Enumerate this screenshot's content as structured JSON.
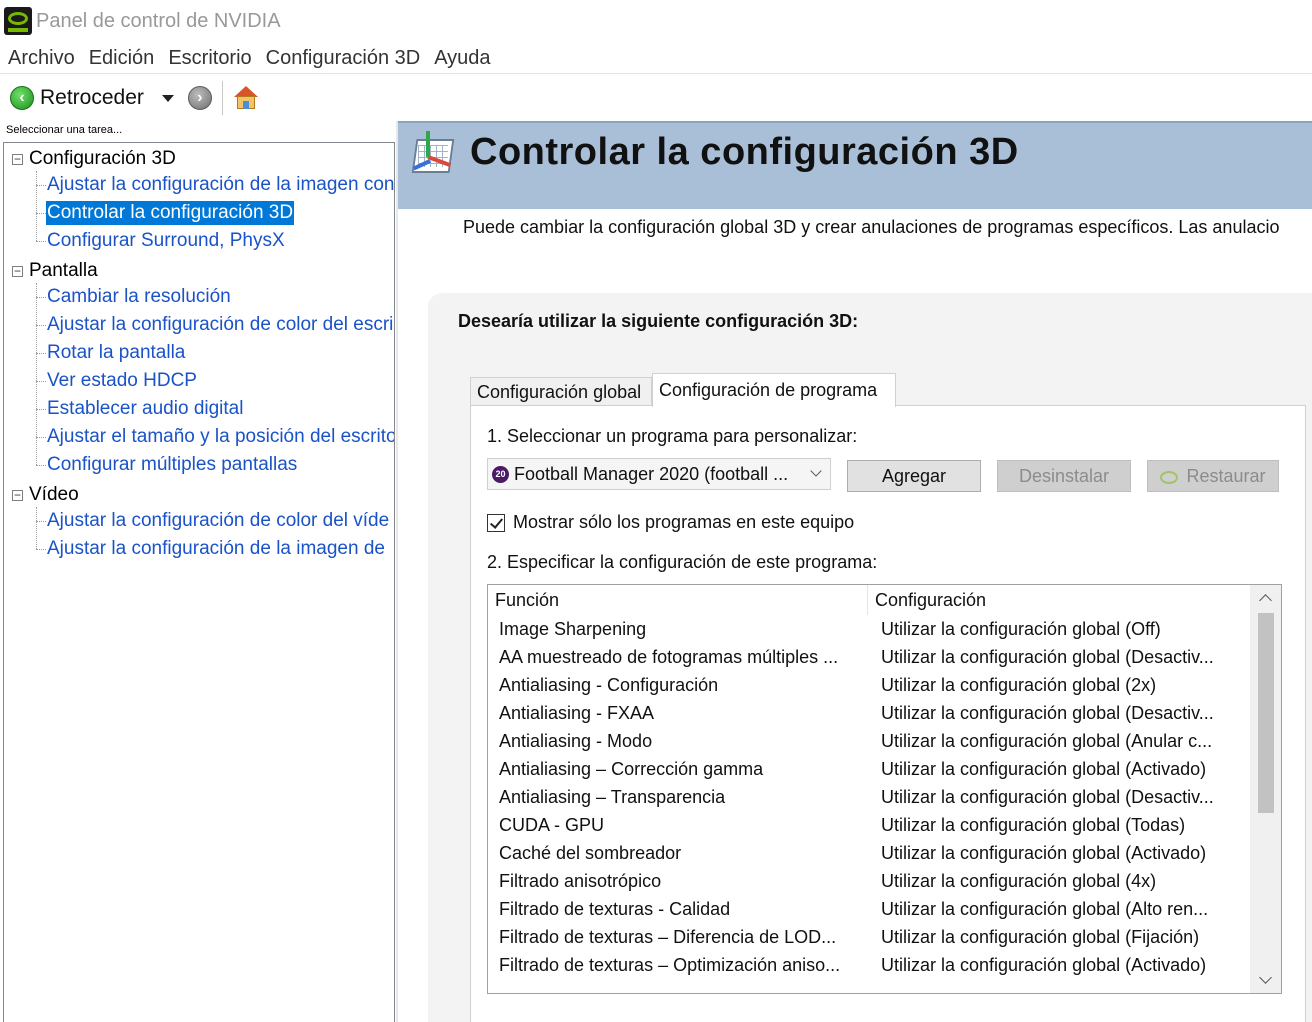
{
  "window": {
    "title": "Panel de control de NVIDIA"
  },
  "menu": [
    "Archivo",
    "Edición",
    "Escritorio",
    "Configuración 3D",
    "Ayuda"
  ],
  "toolbar": {
    "back_label": "Retroceder"
  },
  "tasks": {
    "caption": "Seleccionar una tarea...",
    "categories": [
      {
        "label": "Configuración 3D",
        "items": [
          "Ajustar la configuración de la imagen con",
          "Controlar la configuración 3D",
          "Configurar Surround, PhysX"
        ]
      },
      {
        "label": "Pantalla",
        "items": [
          "Cambiar la resolución",
          "Ajustar la configuración de color del escri",
          "Rotar la pantalla",
          "Ver estado HDCP",
          "Establecer audio digital",
          "Ajustar el tamaño y la posición del escrito",
          "Configurar múltiples pantallas"
        ]
      },
      {
        "label": "Vídeo",
        "items": [
          "Ajustar la configuración de color del víde",
          "Ajustar la configuración de la imagen de"
        ]
      }
    ],
    "selected": "Controlar la configuración 3D"
  },
  "page": {
    "title": "Controlar la configuración 3D",
    "description": "Puede cambiar la configuración global 3D y crear anulaciones de programas específicos. Las anulacio",
    "section_title": "Desearía utilizar la siguiente configuración 3D:",
    "tabs": [
      "Configuración global",
      "Configuración de programa"
    ],
    "active_tab": "Configuración de programa",
    "step1_label": "1. Seleccionar un programa para personalizar:",
    "program_selected": "Football Manager 2020 (football ...",
    "program_icon_text": "20",
    "buttons": {
      "add": "Agregar",
      "remove": "Desinstalar",
      "restore": "Restaurar"
    },
    "checkbox": {
      "label": "Mostrar sólo los programas en este equipo",
      "checked": true
    },
    "step2_label": "2. Especificar la configuración de este programa:",
    "columns": [
      "Función",
      "Configuración"
    ],
    "settings": [
      {
        "feature": "Image Sharpening",
        "value": "Utilizar la configuración global (Off)"
      },
      {
        "feature": "AA muestreado de fotogramas múltiples ...",
        "value": "Utilizar la configuración global (Desactiv..."
      },
      {
        "feature": "Antialiasing - Configuración",
        "value": "Utilizar la configuración global (2x)"
      },
      {
        "feature": "Antialiasing - FXAA",
        "value": "Utilizar la configuración global (Desactiv..."
      },
      {
        "feature": "Antialiasing - Modo",
        "value": "Utilizar la configuración global (Anular c..."
      },
      {
        "feature": "Antialiasing – Corrección gamma",
        "value": "Utilizar la configuración global (Activado)"
      },
      {
        "feature": "Antialiasing – Transparencia",
        "value": "Utilizar la configuración global (Desactiv..."
      },
      {
        "feature": "CUDA - GPU",
        "value": "Utilizar la configuración global (Todas)"
      },
      {
        "feature": "Caché del sombreador",
        "value": "Utilizar la configuración global (Activado)"
      },
      {
        "feature": "Filtrado anisotrópico",
        "value": "Utilizar la configuración global (4x)"
      },
      {
        "feature": "Filtrado de texturas - Calidad",
        "value": "Utilizar la configuración global (Alto ren..."
      },
      {
        "feature": "Filtrado de texturas – Diferencia de LOD...",
        "value": "Utilizar la configuración global (Fijación)"
      },
      {
        "feature": "Filtrado de texturas – Optimización aniso...",
        "value": "Utilizar la configuración global (Activado)"
      }
    ]
  },
  "colors": {
    "header_band": "#a9bfd7",
    "link_blue": "#1a52c8",
    "selection_blue": "#0078d7",
    "nvidia_green": "#76b900"
  }
}
